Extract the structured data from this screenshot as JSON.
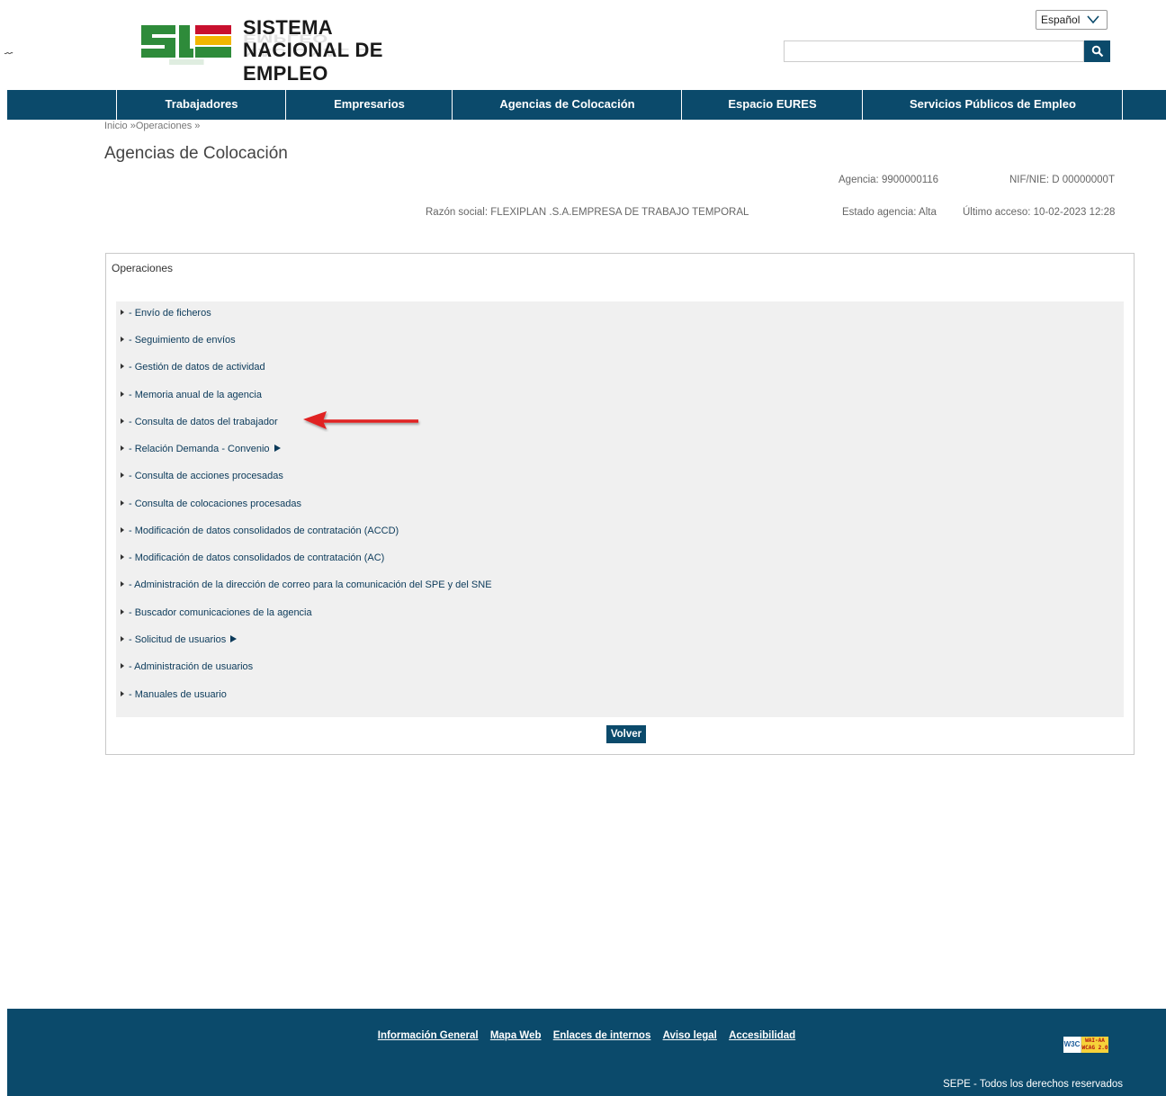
{
  "corner_glyph": "⌇",
  "logo": {
    "line1": "SISTEMA",
    "line2": "NACIONAL DE EMPLEO",
    "colors": {
      "green": "#2e8b3a",
      "dark": "#1a1a1a"
    }
  },
  "language": {
    "selected": "Español"
  },
  "search": {
    "placeholder": "",
    "value": ""
  },
  "nav": {
    "items": [
      {
        "label": "Trabajadores"
      },
      {
        "label": "Empresarios"
      },
      {
        "label": "Agencias de Colocación"
      },
      {
        "label": "Espacio EURES"
      },
      {
        "label": "Servicios Públicos de Empleo"
      }
    ]
  },
  "breadcrumb": "Inicio »Operaciones »",
  "page_title": "Agencias de Colocación",
  "agency": {
    "agencia": "Agencia: 9900000116",
    "nif": "NIF/NIE: D 00000000T",
    "razon_social": "Razón social: FLEXIPLAN .S.A.EMPRESA DE TRABAJO TEMPORAL",
    "estado": "Estado agencia: Alta",
    "ultimo_acceso": "Último acceso: 10-02-2023 12:28"
  },
  "operations": {
    "title": "Operaciones",
    "items": [
      {
        "label": "- Envío de ficheros",
        "submenu": false
      },
      {
        "label": "- Seguimiento de envíos",
        "submenu": false
      },
      {
        "label": "- Gestión de datos de actividad",
        "submenu": false
      },
      {
        "label": "- Memoria anual de la agencia",
        "submenu": false
      },
      {
        "label": "- Consulta de datos del trabajador",
        "submenu": false
      },
      {
        "label": "- Relación Demanda - Convenio",
        "submenu": true
      },
      {
        "label": "- Consulta de acciones procesadas",
        "submenu": false
      },
      {
        "label": "- Consulta de colocaciones procesadas",
        "submenu": false
      },
      {
        "label": "- Modificación de datos consolidados de contratación (ACCD)",
        "submenu": false
      },
      {
        "label": "- Modificación de datos consolidados de contratación (AC)",
        "submenu": false
      },
      {
        "label": "- Administración de la dirección de correo para la comunicación del SPE y del SNE",
        "submenu": false
      },
      {
        "label": "- Buscador comunicaciones de la agencia",
        "submenu": false
      },
      {
        "label": "- Solicitud de usuarios",
        "submenu": true
      },
      {
        "label": "- Administración de usuarios",
        "submenu": false
      },
      {
        "label": "- Manuales de usuario",
        "submenu": false
      }
    ],
    "volver_label": "Volver"
  },
  "annotation": {
    "color": "#e02020",
    "points_to": "- Consulta de datos del trabajador"
  },
  "footer": {
    "links": [
      "Información General",
      "Mapa Web",
      "Enlaces de internos",
      "Aviso legal",
      "Accesibilidad"
    ],
    "badge_w3c": "W3C",
    "badge_wai_1": "WAI-AA",
    "badge_wai_2": "WCAG 2.0",
    "copyright": "SEPE - Todos los derechos reservados"
  },
  "colors": {
    "primary": "#0b4a6b",
    "link": "#0b3a5a",
    "panel_bg": "#f0f0f0"
  }
}
